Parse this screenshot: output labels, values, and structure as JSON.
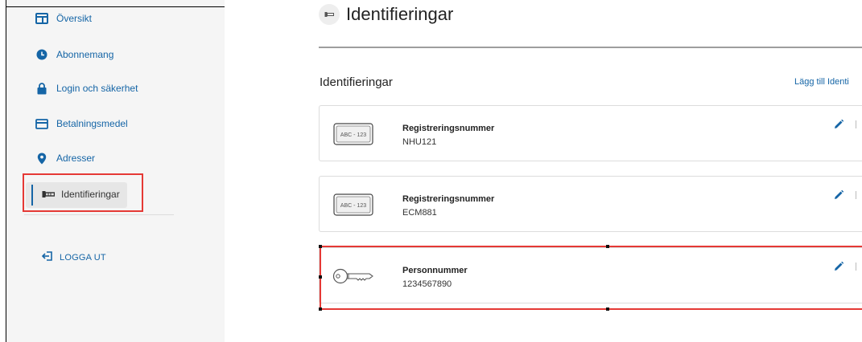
{
  "sidebar": {
    "items": [
      {
        "label": "Översikt",
        "icon": "dashboard-icon"
      },
      {
        "label": "Abonnemang",
        "icon": "clock-icon"
      },
      {
        "label": "Login och säkerhet",
        "icon": "lock-icon"
      },
      {
        "label": "Betalningsmedel",
        "icon": "credit-card-icon"
      },
      {
        "label": "Adresser",
        "icon": "location-pin-icon"
      },
      {
        "label": "Identifieringar",
        "icon": "key-icon",
        "active": true
      }
    ],
    "logout_label": "LOGGA UT"
  },
  "header": {
    "title": "Identifieringar"
  },
  "section": {
    "title": "Identifieringar",
    "add_link": "Lägg till Identi"
  },
  "cards": [
    {
      "type_label": "Registreringsnummer",
      "value": "NHU121",
      "icon": "license-plate-icon",
      "plate_text": "ABC - 123"
    },
    {
      "type_label": "Registreringsnummer",
      "value": "ECM881",
      "icon": "license-plate-icon",
      "plate_text": "ABC - 123"
    },
    {
      "type_label": "Personnummer",
      "value": "1234567890",
      "icon": "key-icon"
    }
  ],
  "colors": {
    "accent": "#1565a6",
    "highlight": "#e53935",
    "sidebar_bg": "#f5f5f5"
  }
}
